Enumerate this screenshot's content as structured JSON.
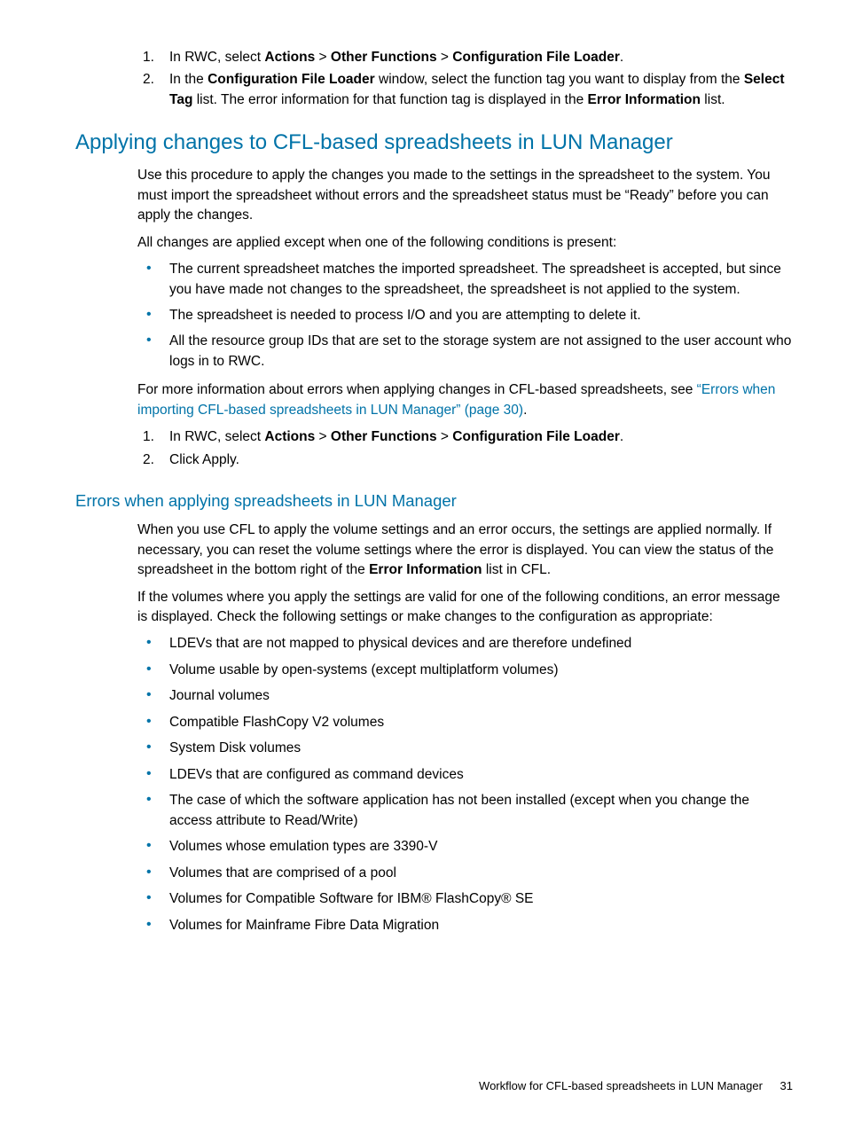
{
  "top_ol": [
    [
      {
        "t": "In RWC, select "
      },
      {
        "t": "Actions",
        "b": true
      },
      {
        "t": " > "
      },
      {
        "t": "Other Functions",
        "b": true
      },
      {
        "t": " > "
      },
      {
        "t": "Configuration File Loader",
        "b": true
      },
      {
        "t": "."
      }
    ],
    [
      {
        "t": "In the "
      },
      {
        "t": "Configuration File Loader",
        "b": true
      },
      {
        "t": " window, select the function tag you want to display from the "
      },
      {
        "t": "Select Tag",
        "b": true
      },
      {
        "t": " list. The error information for that function tag is displayed in the "
      },
      {
        "t": "Error Information",
        "b": true
      },
      {
        "t": " list."
      }
    ]
  ],
  "h2_apply": "Applying changes to CFL-based spreadsheets in LUN Manager",
  "apply_p1": "Use this procedure to apply the changes you made to the settings in the spreadsheet to the system. You must import the spreadsheet without errors and the spreadsheet status must be “Ready” before you can apply the changes.",
  "apply_p2": "All changes are applied except when one of the following conditions is present:",
  "apply_ul": [
    "The current spreadsheet matches the imported spreadsheet. The spreadsheet is accepted, but since you have made not changes to the spreadsheet, the spreadsheet is not applied to the system.",
    "The spreadsheet is needed to process I/O and you are attempting to delete it.",
    "All the resource group IDs that are set to the storage system are not assigned to the user account who logs in to RWC."
  ],
  "apply_p3_parts": [
    {
      "t": "For more information about errors when applying changes in CFL-based spreadsheets, see "
    },
    {
      "t": "“Errors when importing CFL-based spreadsheets in LUN Manager” (page 30)",
      "link": true
    },
    {
      "t": "."
    }
  ],
  "apply_ol": [
    [
      {
        "t": "In RWC, select "
      },
      {
        "t": "Actions",
        "b": true
      },
      {
        "t": " > "
      },
      {
        "t": "Other Functions",
        "b": true
      },
      {
        "t": " > "
      },
      {
        "t": "Configuration File Loader",
        "b": true
      },
      {
        "t": "."
      }
    ],
    [
      {
        "t": "Click Apply."
      }
    ]
  ],
  "h3_errors": "Errors when applying spreadsheets in LUN Manager",
  "err_p1_parts": [
    {
      "t": "When you use CFL to apply the volume settings and an error occurs, the settings are applied normally. If necessary, you can reset the volume settings where the error is displayed. You can view the status of the spreadsheet in the bottom right of the "
    },
    {
      "t": "Error Information",
      "b": true
    },
    {
      "t": " list in CFL."
    }
  ],
  "err_p2": "If the volumes where you apply the settings are valid for one of the following conditions, an error message is displayed. Check the following settings or make changes to the configuration as appropriate:",
  "err_ul": [
    "LDEVs that are not mapped to physical devices and are therefore undefined",
    "Volume usable by open-systems (except multiplatform volumes)",
    "Journal volumes",
    "Compatible FlashCopy V2 volumes",
    "System Disk volumes",
    "LDEVs that are configured as command devices",
    "The case of which the software application has not been installed (except when you change the access attribute to Read/Write)",
    "Volumes whose emulation types are 3390-V",
    "Volumes that are comprised of a pool",
    "Volumes for Compatible Software for IBM® FlashCopy® SE",
    "Volumes for Mainframe Fibre Data Migration"
  ],
  "footer_text": "Workflow for CFL-based spreadsheets in LUN Manager",
  "footer_page": "31"
}
